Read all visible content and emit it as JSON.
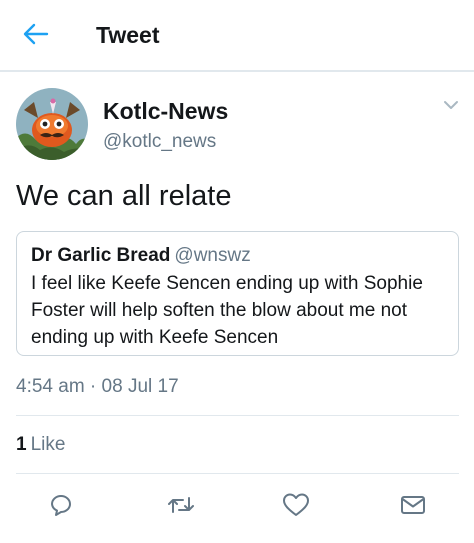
{
  "header": {
    "title": "Tweet"
  },
  "tweet": {
    "author_name": "Kotlc-News",
    "author_handle": "@kotlc_news",
    "text": "We can all relate",
    "quote": {
      "author_name": "Dr Garlic Bread",
      "author_handle": "@wnswz",
      "text": "I feel like Keefe Sencen ending up with Sophie Foster will help soften the blow about me not ending up with Keefe Sencen"
    },
    "timestamp": "4:54 am · 08 Jul 17",
    "likes_count": "1",
    "likes_label": "Like"
  },
  "icons": {
    "back": "back-arrow-icon",
    "caret": "chevron-down-icon",
    "reply": "reply-icon",
    "retweet": "retweet-icon",
    "like": "heart-icon",
    "share": "share-icon"
  },
  "colors": {
    "accent": "#1da1f2",
    "secondary_text": "#657786",
    "border": "#e1e8ed"
  }
}
